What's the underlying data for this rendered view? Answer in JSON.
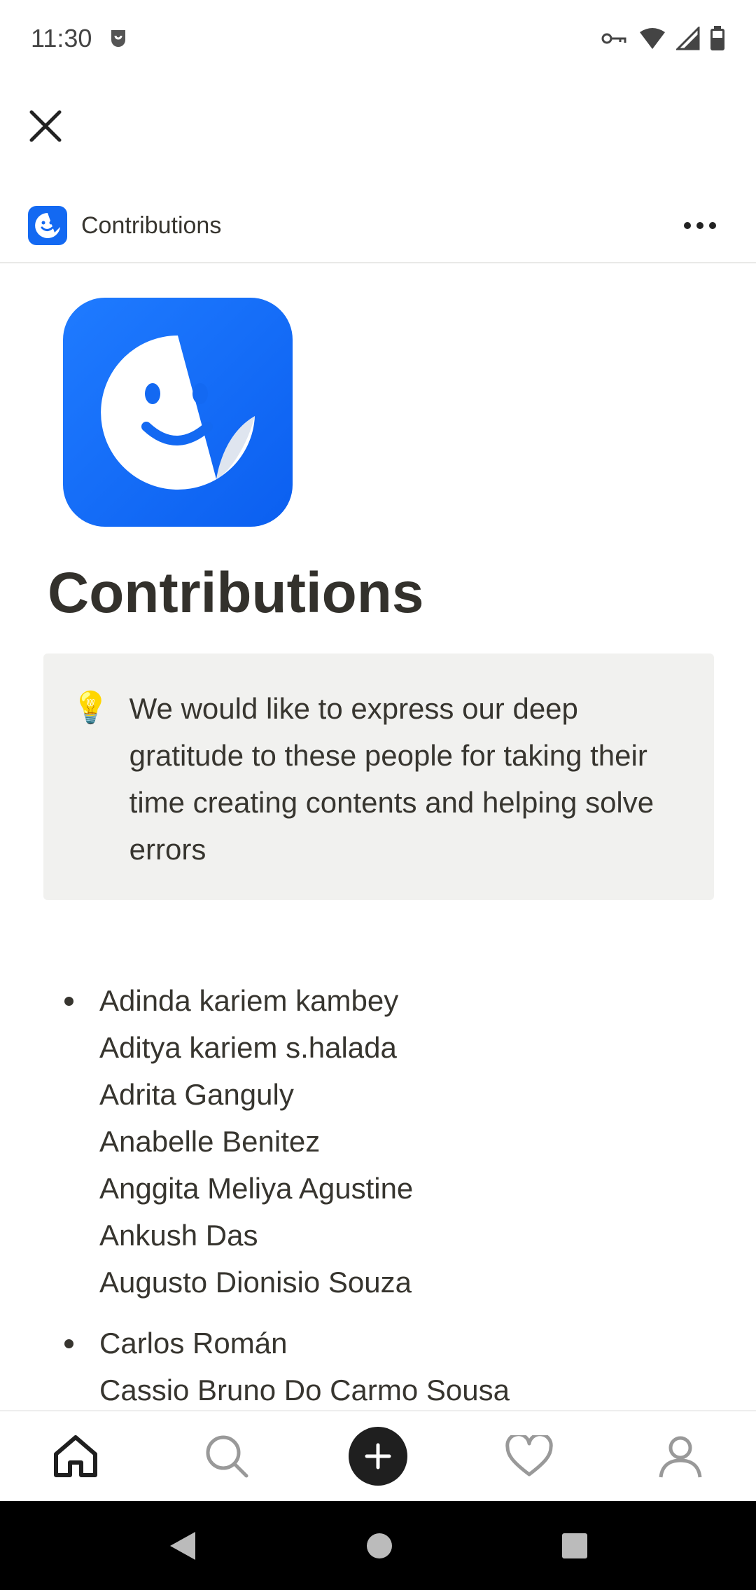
{
  "status_bar": {
    "time": "11:30",
    "icons": [
      "notification-icon",
      "vpn-key-icon",
      "wifi-icon",
      "signal-icon",
      "battery-icon"
    ]
  },
  "header": {
    "title": "Contributions",
    "app_icon": "sticker-smile-icon"
  },
  "page": {
    "title": "Contributions",
    "callout": {
      "icon": "lightbulb-icon",
      "text": "We would like to express our deep gratitude to these people for taking their time creating contents and helping solve errors"
    },
    "contributors": [
      {
        "names": [
          "Adinda kariem kambey",
          "Aditya kariem s.halada",
          "Adrita Ganguly",
          "Anabelle Benitez",
          "Anggita Meliya Agustine",
          "Ankush Das",
          "Augusto Dionisio Souza"
        ]
      },
      {
        "names": [
          "Carlos Román",
          "Cassio Bruno Do Carmo Sousa"
        ]
      }
    ]
  },
  "bottom_nav": {
    "items": [
      "home-icon",
      "search-icon",
      "add-icon",
      "heart-icon",
      "profile-icon"
    ]
  },
  "colors": {
    "accent": "#1369f2",
    "callout_bg": "#f1f1ef",
    "text": "#37352f"
  }
}
